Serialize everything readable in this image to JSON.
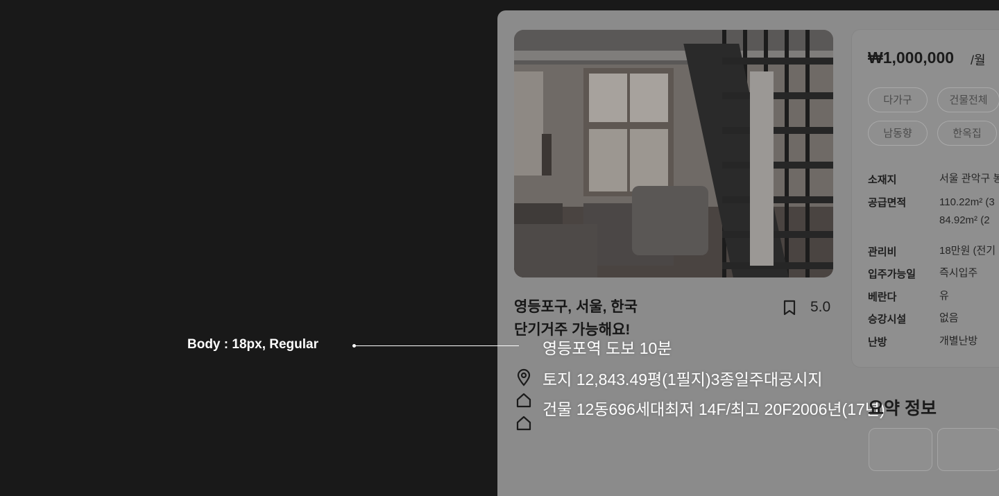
{
  "annotation": {
    "label": "Body : 18px, Regular"
  },
  "listing": {
    "title_line1": "영등포구, 서울, 한국",
    "title_line2": "단기거주 가능해요!",
    "rating": "5.0"
  },
  "info_lines": [
    {
      "text": "영등포역 도보 10분",
      "icon": "none"
    },
    {
      "text": "토지 12,843.49평(1필지)3종일주대공시지",
      "icon": "location-pin-icon"
    },
    {
      "text": "건물 12동696세대최저 14F/최고 20F2006년(17년)",
      "icon": "home-icon"
    }
  ],
  "side_panel": {
    "price": "₩1,000,000",
    "price_unit": "/월",
    "tags": [
      "다가구",
      "건물전체",
      "남동향",
      "한옥집"
    ],
    "specs": [
      {
        "label": "소재지",
        "value": "서울 관악구 봉"
      },
      {
        "label": "공급면적",
        "value": "110.22m² (3",
        "value2": "84.92m² (2"
      },
      {
        "label": "관리비",
        "value": "18만원 (전기"
      },
      {
        "label": "입주가능일",
        "value": "즉시입주"
      },
      {
        "label": "베란다",
        "value": "유"
      },
      {
        "label": "승강시설",
        "value": "없음"
      },
      {
        "label": "난방",
        "value": "개별난방"
      }
    ],
    "section2_title": "요약 정보"
  },
  "colors": {
    "page_bg": "#191919",
    "card_overlay": "#8b8b8b",
    "annotation_text": "#ffffff"
  }
}
